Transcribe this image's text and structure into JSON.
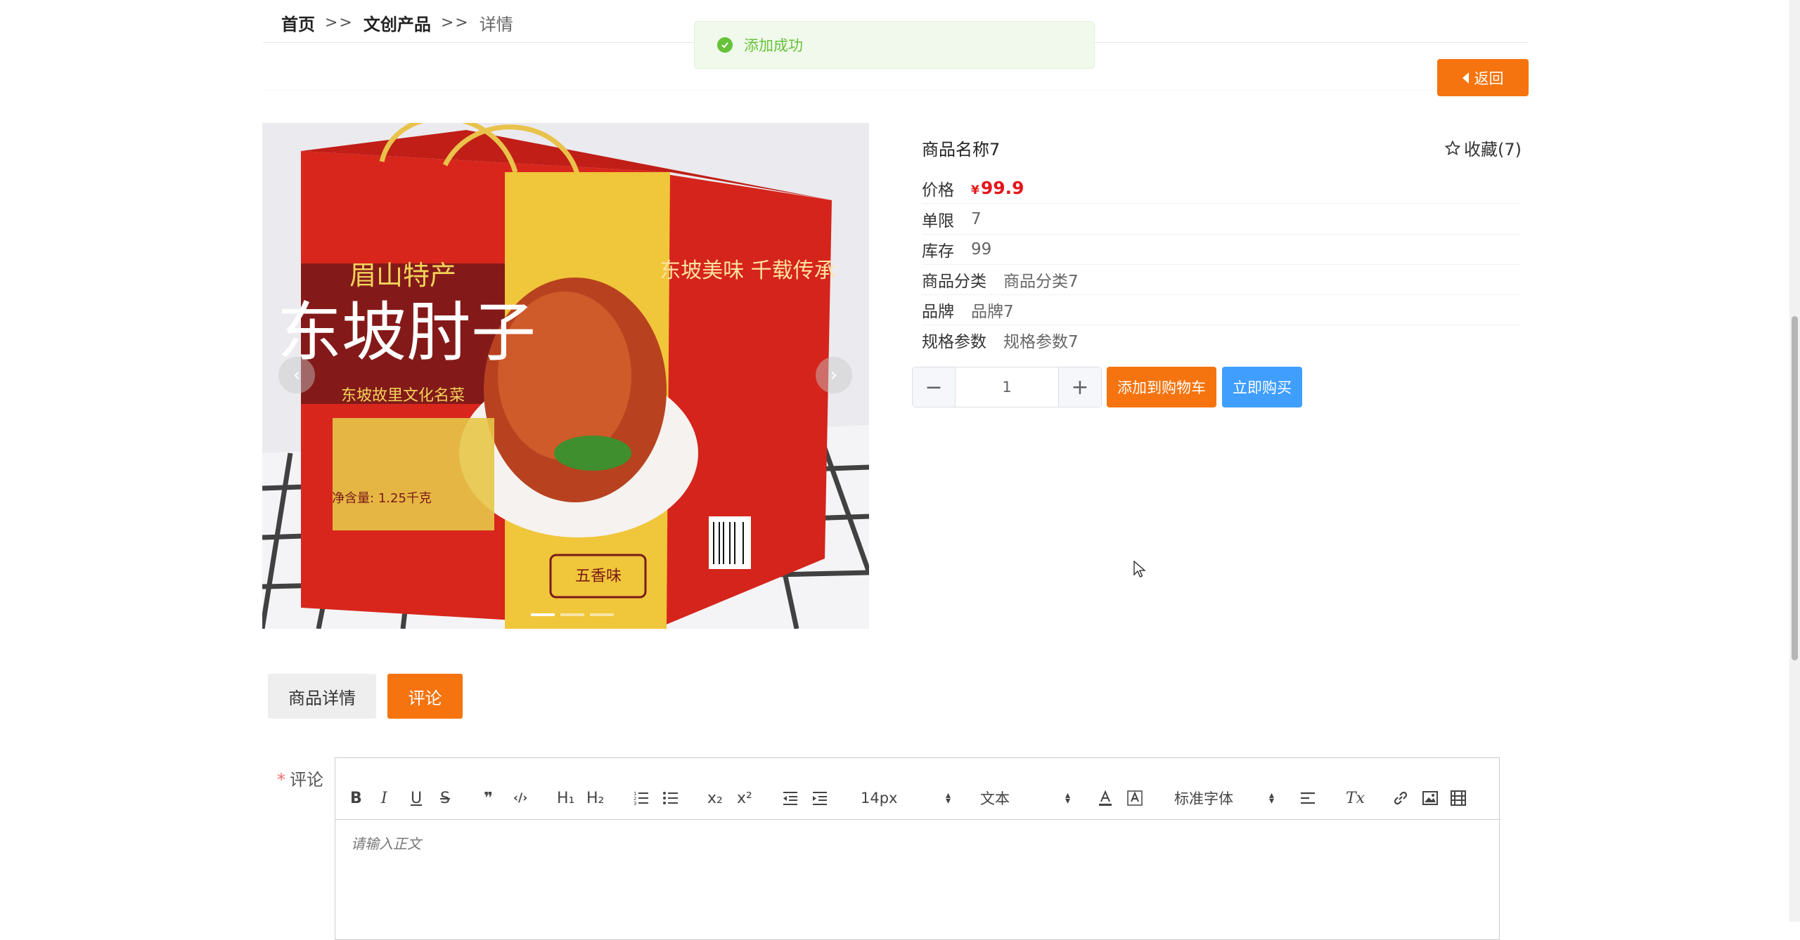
{
  "breadcrumb": {
    "home": "首页",
    "category": "文创产品",
    "current": "详情",
    "separator": ">>"
  },
  "toast": {
    "message": "添加成功"
  },
  "back_button": {
    "label": "返回"
  },
  "product": {
    "name": "商品名称7",
    "favorite_label": "收藏(7)",
    "price_label": "价格",
    "price_currency": "¥",
    "price_value": "99.9",
    "limit_label": "单限",
    "limit_value": "7",
    "stock_label": "库存",
    "stock_value": "99",
    "category_label": "商品分类",
    "category_value": "商品分类7",
    "brand_label": "品牌",
    "brand_value": "品牌7",
    "spec_label": "规格参数",
    "spec_value": "规格参数7",
    "image_text": {
      "origin": "眉山特产",
      "title": "东坡肘子",
      "subtitle": "东坡故里文化名菜",
      "slogan": "东坡美味  千载传承",
      "flavor": "五香味",
      "weight": "净含量: 1.25千克"
    }
  },
  "carousel": {
    "slide_count": 3,
    "active_index": 0
  },
  "quantity": {
    "value": "1",
    "minus": "−",
    "plus": "+"
  },
  "actions": {
    "add_to_cart": "添加到购物车",
    "buy_now": "立即购买"
  },
  "tabs": {
    "details": "商品详情",
    "comments": "评论",
    "active": "comments"
  },
  "comment_form": {
    "label": "评论",
    "required_mark": "*",
    "placeholder": "请输入正文",
    "toolbar": {
      "bold": "B",
      "italic": "I",
      "underline": "U",
      "strike": "S",
      "quote": "❞",
      "code": "‹/›",
      "h1": "H₁",
      "h2": "H₂",
      "subscript": "x₂",
      "superscript": "x²",
      "font_size": "14px",
      "text_type": "文本",
      "font_family": "标准字体",
      "clear_format": "Tx"
    }
  },
  "colors": {
    "accent": "#f5740f",
    "primary": "#409eff",
    "price": "#e4161b",
    "success": "#67c23a"
  }
}
